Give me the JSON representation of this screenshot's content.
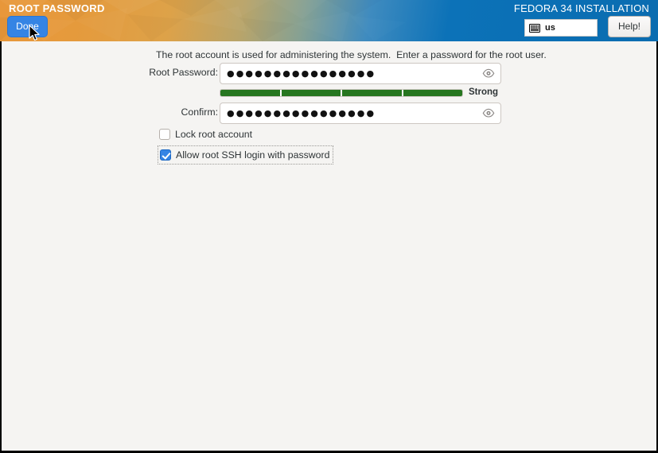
{
  "header": {
    "spoke_title": "ROOT PASSWORD",
    "install_title": "FEDORA 34 INSTALLATION",
    "done_label": "Done",
    "help_label": "Help!",
    "keyboard_layout": "us",
    "keyboard_icon": "keyboard-icon",
    "gradient_start_color": "#e8973a",
    "gradient_end_color": "#0a6cb0"
  },
  "main": {
    "description": "The root account is used for administering the system.  Enter a password for the root user.",
    "root_password": {
      "label": "Root Password:",
      "value": "●●●●●●●●●●●●●●●●",
      "reveal_icon": "eye-icon"
    },
    "confirm_password": {
      "label": "Confirm:",
      "value": "●●●●●●●●●●●●●●●●",
      "reveal_icon": "eye-icon"
    },
    "strength": {
      "label": "Strong",
      "segments_filled": 4,
      "segments_total": 4,
      "color": "#26761f"
    },
    "options": [
      {
        "label": "Lock root account",
        "checked": false
      },
      {
        "label": "Allow root SSH login with password",
        "checked": true
      }
    ],
    "accent_color": "#3584e4",
    "background_color": "#f5f4f2"
  }
}
